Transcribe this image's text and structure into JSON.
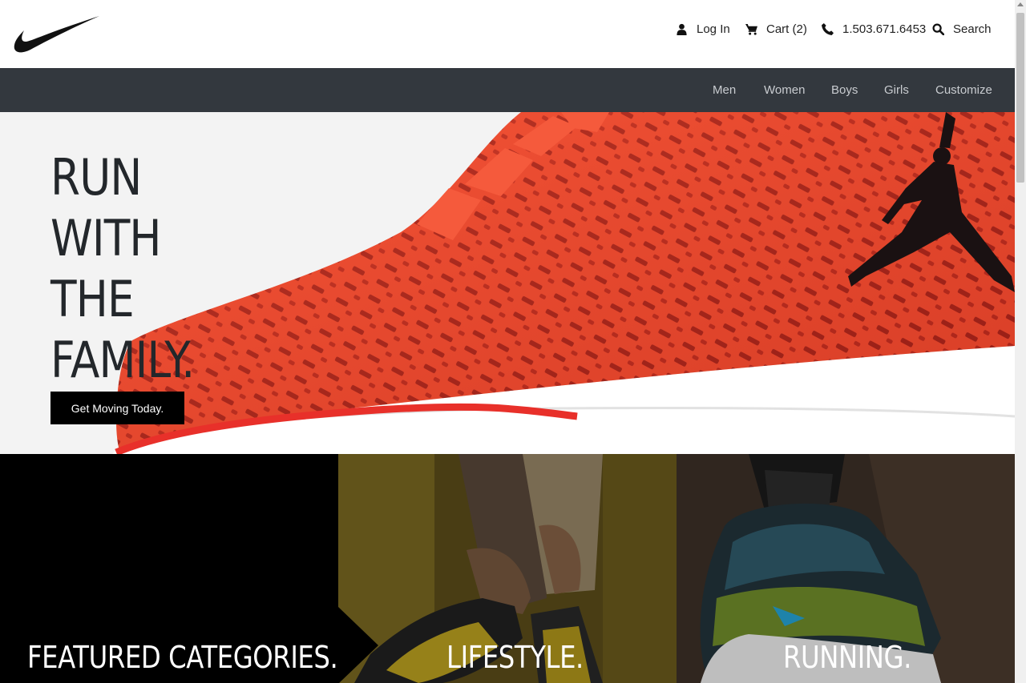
{
  "header": {
    "brand": "Nike",
    "login_label": "Log In",
    "cart_label": "Cart (2)",
    "phone": "1.503.671.6453",
    "search_label": "Search"
  },
  "nav": {
    "items": [
      "Men",
      "Women",
      "Boys",
      "Girls",
      "Customize"
    ]
  },
  "hero": {
    "lines": [
      "RUN",
      "WITH",
      "THE",
      "FAMILY."
    ],
    "button_label": "Get Moving Today."
  },
  "categories": {
    "featured_label": "FEATURED CATEGORIES.",
    "lifestyle_label": "LIFESTYLE.",
    "running_label": "RUNNING."
  },
  "colors": {
    "nav_bg": "#33383e",
    "shoe_red": "#f04a2f",
    "dark_text": "#23272b"
  },
  "icons": [
    "user-icon",
    "cart-icon",
    "phone-icon",
    "search-icon",
    "nike-swoosh-logo"
  ]
}
